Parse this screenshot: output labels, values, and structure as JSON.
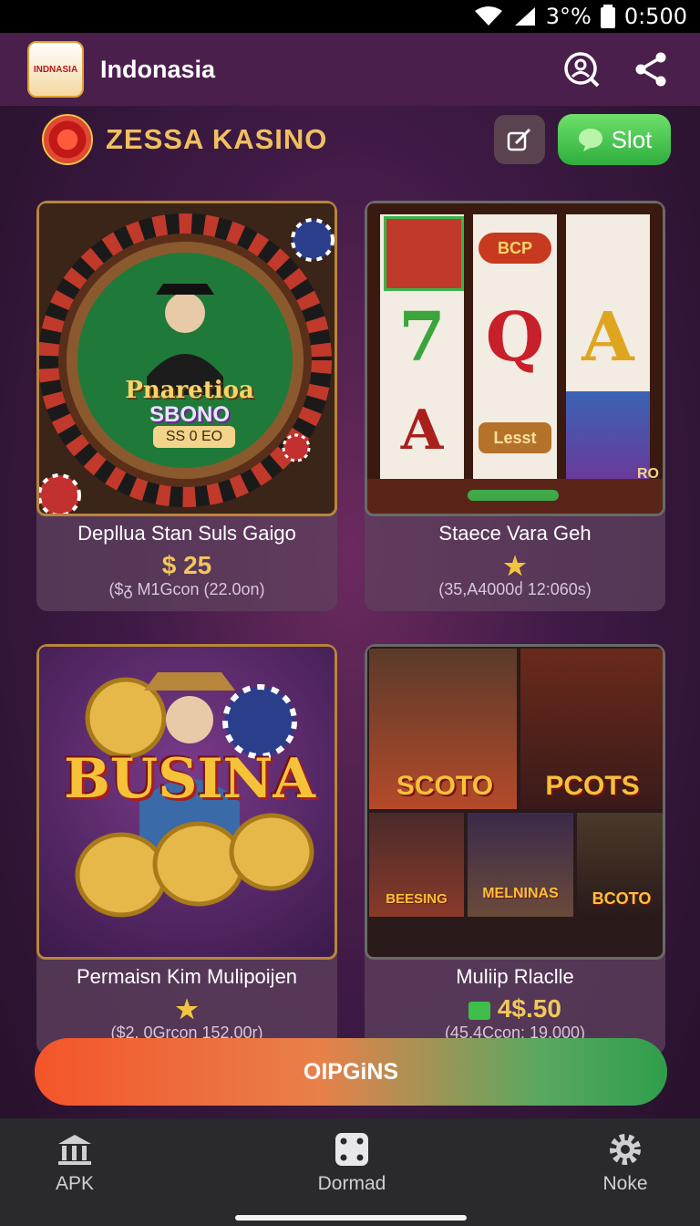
{
  "status": {
    "battery": "3°%",
    "time": "0:500"
  },
  "appbar": {
    "title": "Indonasia",
    "logo_text": "INDNASIA"
  },
  "brand": {
    "name": "ZESSA KASINO",
    "slot_label": "Slot"
  },
  "cards": [
    {
      "title": "Depllua Stan Suls Gaigo",
      "price": "$ 25",
      "meta": "($ᵹ M1Gcon (22.0on)",
      "art": {
        "line1": "Pnaretioa",
        "line2": "SBONO",
        "line3": "SS 0 EO"
      }
    },
    {
      "title": "Staece Vara Geh",
      "rating_stars": 1,
      "meta": "(35,A4000ძ 12:060s)",
      "art": {
        "reel1": "7",
        "reel2": "Q",
        "reel3": "A",
        "reel4": "A",
        "badge1": "BCP",
        "badge2": "Lesst",
        "corner": "RO"
      }
    },
    {
      "title": "Permaisn Kim Mulipoijen",
      "rating_stars": 1,
      "meta": "($2, 0Grcon 152.00r)",
      "art": {
        "headline": "BUSINA"
      }
    },
    {
      "title": "Muliip Rlaclle",
      "price": "4$.50",
      "meta": "(45,4Ccon: 19.000)",
      "art": {
        "tile1": "SCOTO",
        "tile2": "PCOTS",
        "tile3": "BEESING",
        "tile4": "MELNINAS",
        "tile5": "BCOTO"
      }
    }
  ],
  "cta": {
    "label": "OIPGiNS"
  },
  "nav": [
    {
      "label": "APK",
      "icon": "bank-icon"
    },
    {
      "label": "Dormad",
      "icon": "dice-icon"
    },
    {
      "label": "Noke",
      "icon": "gear-icon"
    }
  ],
  "colors": {
    "accent_gold": "#f2c75a",
    "cta_start": "#f4552a",
    "cta_end": "#2f9e4a",
    "slot_green": "#3fbf4a"
  }
}
